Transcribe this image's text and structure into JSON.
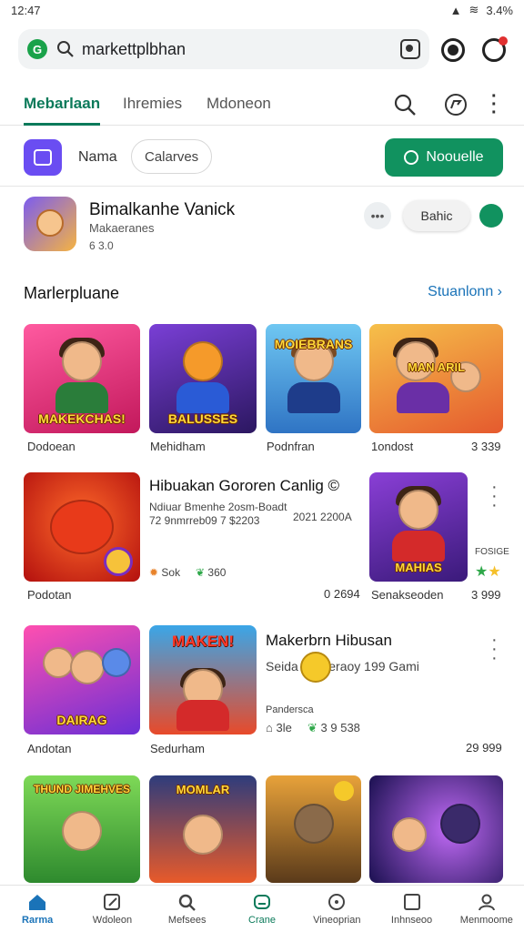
{
  "status_bar": {
    "time": "12:47",
    "battery": "3.4%"
  },
  "search": {
    "value": "markettplbhan"
  },
  "tabs": [
    {
      "label": "Mebarlaan",
      "active": true
    },
    {
      "label": "Ihremies",
      "active": false
    },
    {
      "label": "Mdoneon",
      "active": false
    }
  ],
  "filters": {
    "name_label": "Nama",
    "chip_label": "Calarves",
    "cta_label": "Noouelle"
  },
  "featured": {
    "title": "Bimalkanhe Vanick",
    "subtitle": "Makaeranes",
    "meta": "6 3.0",
    "button_label": "Bahic",
    "more_label": "•••"
  },
  "section": {
    "title": "Marlerpluane",
    "link": "Stuanlonn"
  },
  "row1": {
    "tiles": [
      {
        "text": "MAKEKCHAS!",
        "caption": "Dodoean",
        "bg": "#e8387a"
      },
      {
        "text": "BALUSSES",
        "caption": "Mehidham",
        "bg": "#5a2ea6"
      },
      {
        "text": "MOIEBRANS",
        "caption": "Podnfran",
        "bg": "#2f9bd8"
      },
      {
        "text": "MAN ARIL",
        "caption": "1ondost",
        "bg": "#f0a23a"
      }
    ],
    "extra_value": "3 339"
  },
  "row2": {
    "tile_caption": "Podotan",
    "title": "Hibuakan Gororen Canlig ©",
    "desc_line1": "Ndiuar Bmenhe  2osm-Boadt",
    "desc_line2": "72 9nmrreb09   7 $2203",
    "desc_right": "2021 2200A",
    "rating1": "Sok",
    "rating2": "360",
    "value_left": "0 2694",
    "right_tile_caption": "Senakseoden",
    "right_tile_text": "MAHIAS",
    "right_value": "3 999",
    "right_small": "FOSIGE"
  },
  "row3": {
    "tile1_caption": "Andotan",
    "tile2_caption": "Sedurham",
    "tile1_text": "DAIRAG",
    "tile2_text": "MAKEN!",
    "title": "Makerbrn Hibusan",
    "line": "Seida       Cameraoy 199 Gami",
    "small_label": "Pandersca",
    "stats_a": "3le",
    "stats_b": "3 9 538",
    "value": "29 999"
  },
  "row4": {
    "tiles": [
      {
        "text": "THUND JIMEHVES",
        "bg": "#4caf50"
      },
      {
        "text": "MOMLAR",
        "bg": "#2e3c7c"
      },
      {
        "text": "",
        "bg": "#8a5a2a"
      },
      {
        "text": "",
        "bg": "#5a2a9a"
      }
    ]
  },
  "bottom_nav": [
    {
      "label": "Rarma",
      "icon": "home-icon"
    },
    {
      "label": "Wdoleon",
      "icon": "edit-icon"
    },
    {
      "label": "Mefsees",
      "icon": "search-icon"
    },
    {
      "label": "Crane",
      "icon": "apps-icon"
    },
    {
      "label": "Vineoprian",
      "icon": "circle-icon"
    },
    {
      "label": "Inhnseoo",
      "icon": "square-icon"
    },
    {
      "label": "Menmoome",
      "icon": "profile-icon"
    }
  ]
}
